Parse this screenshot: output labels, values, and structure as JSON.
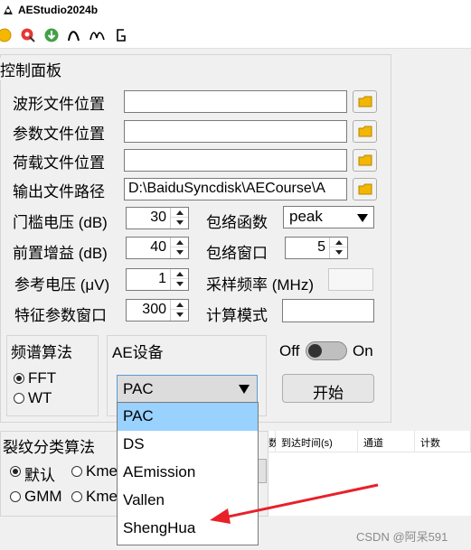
{
  "window": {
    "title": "AEStudio2024b"
  },
  "toolbar": {
    "icons": [
      "sun-icon",
      "record-icon",
      "download-icon",
      "arch-icon",
      "wave-icon",
      "hook-icon"
    ]
  },
  "control_panel": {
    "title": "控制面板",
    "file_rows": [
      {
        "label": "波形文件位置",
        "value": ""
      },
      {
        "label": "参数文件位置",
        "value": ""
      },
      {
        "label": "荷载文件位置",
        "value": ""
      },
      {
        "label": "输出文件路径",
        "value": "D:\\BaiduSyncdisk\\AECourse\\A"
      }
    ],
    "threshold": {
      "label": "门槛电压 (dB)",
      "value": "30"
    },
    "preamp": {
      "label": "前置增益 (dB)",
      "value": "40"
    },
    "ref_voltage": {
      "label": "参考电压 (μV)",
      "value": "1"
    },
    "feature_window": {
      "label": "特征参数窗口",
      "value": "300"
    },
    "envelope_fn": {
      "label": "包络函数",
      "value": "peak"
    },
    "envelope_window": {
      "label": "包络窗口",
      "value": "5"
    },
    "sample_rate": {
      "label": "采样频率 (MHz)",
      "value": ""
    },
    "calc_mode": {
      "label": "计算模式",
      "value": ""
    }
  },
  "spectrum": {
    "title": "频谱算法",
    "options": [
      {
        "label": "FFT",
        "selected": true
      },
      {
        "label": "WT",
        "selected": false
      }
    ]
  },
  "ae_device": {
    "title": "AE设备",
    "selected": "PAC",
    "options": [
      "PAC",
      "DS",
      "AEmission",
      "Vallen",
      "ShengHua"
    ]
  },
  "toggle": {
    "off_label": "Off",
    "on_label": "On",
    "state": "off"
  },
  "start_button": {
    "label": "开始"
  },
  "crack": {
    "title": "裂纹分类算法",
    "options": [
      {
        "label": "默认",
        "selected": true
      },
      {
        "label": "Kme",
        "selected": false
      },
      {
        "label": "GMM",
        "selected": false
      },
      {
        "label": "Kme",
        "selected": false
      }
    ]
  },
  "table": {
    "headers": [
      "数",
      "到达时间(s)",
      "通道",
      "计数"
    ]
  },
  "watermark": "CSDN @阿呆591",
  "colors": {
    "panel_bg": "#f0f0f0",
    "selection": "#99d1ff",
    "annotation_arrow": "#e8202a",
    "accent_border": "#5b9bd5"
  }
}
